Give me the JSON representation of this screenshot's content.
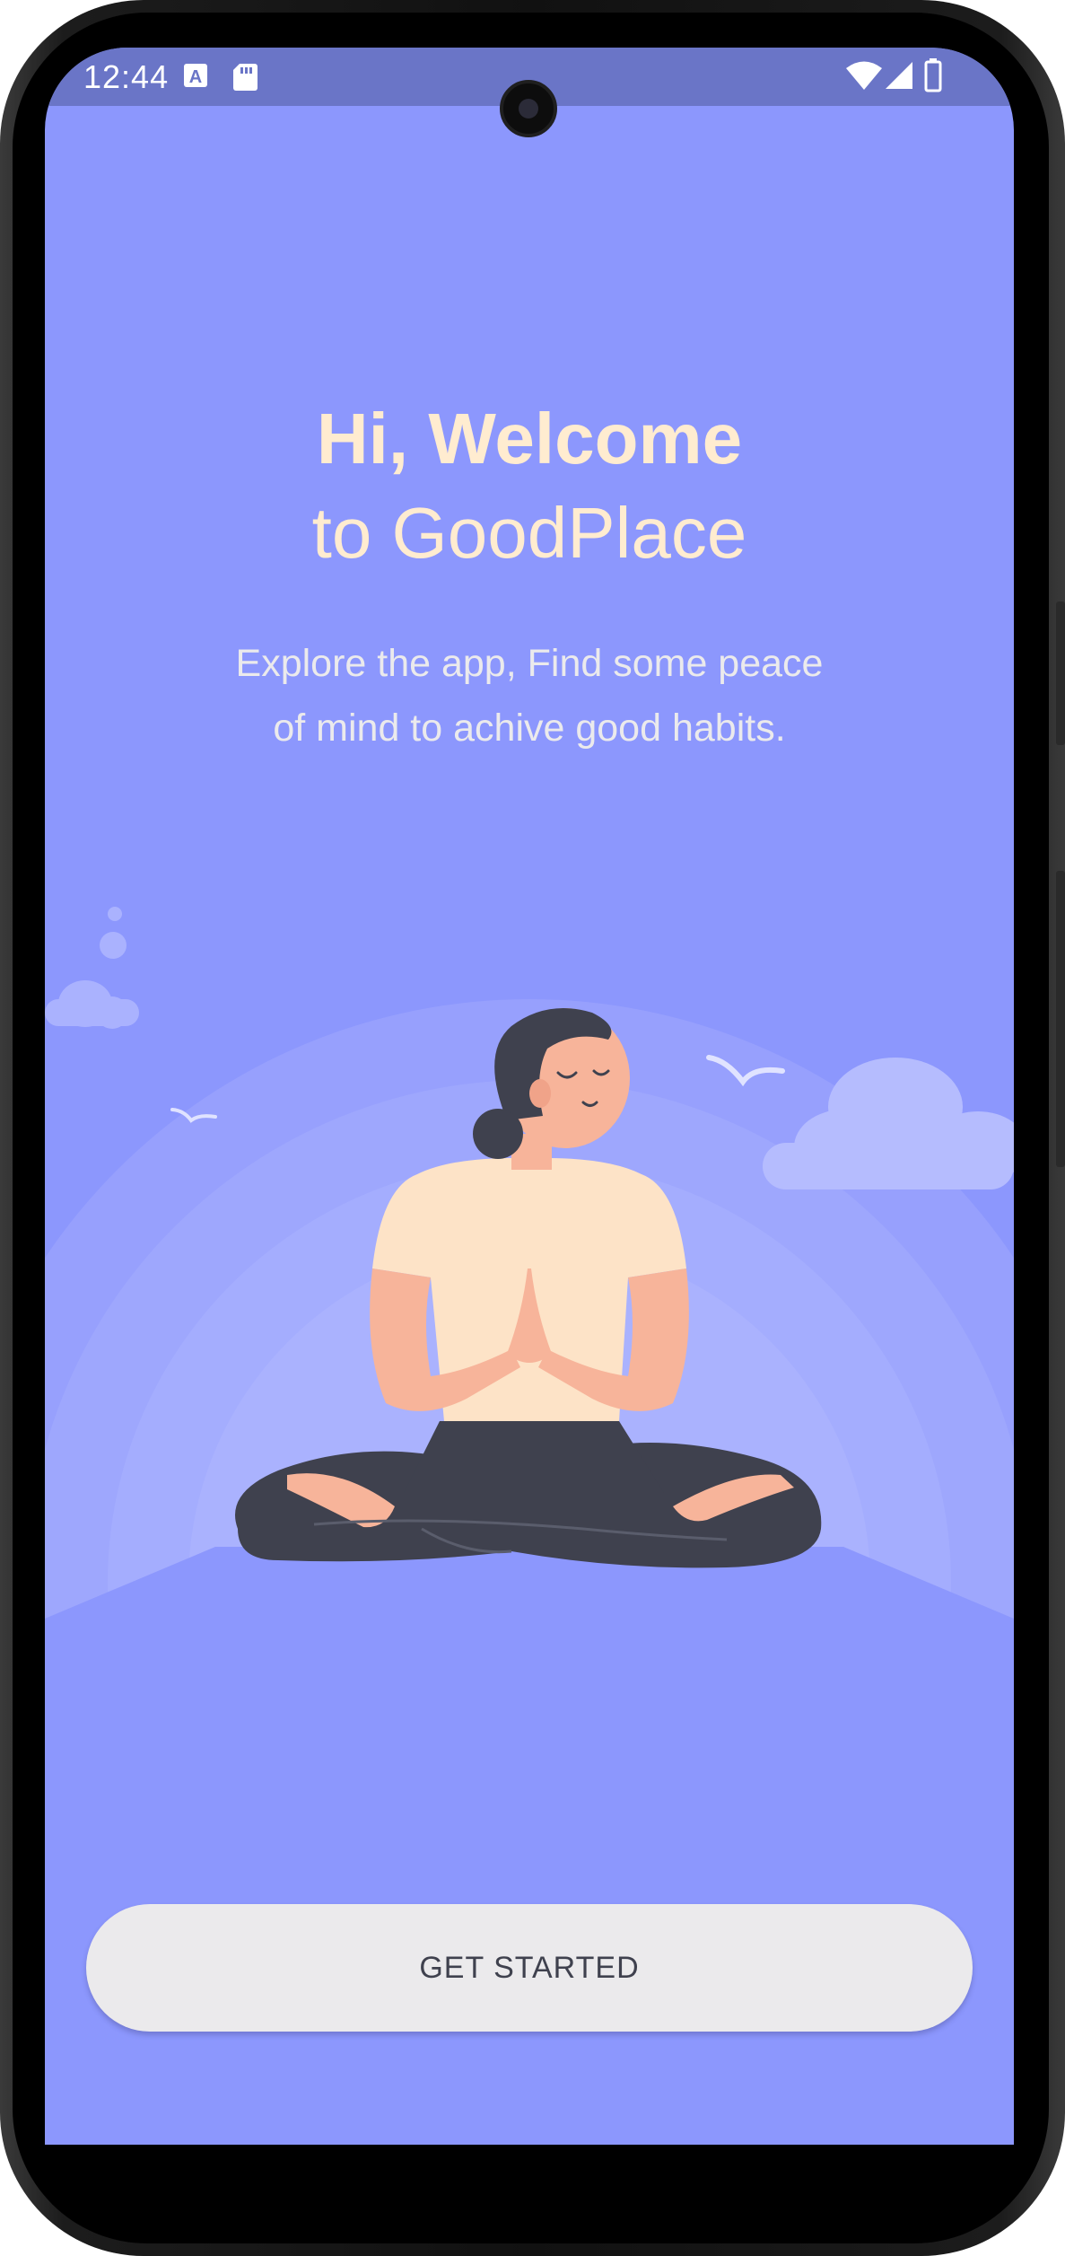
{
  "status_bar": {
    "time": "12:44",
    "icons": [
      "keyboard-a-icon",
      "sd-card-icon",
      "wifi-icon",
      "cellular-signal-icon",
      "battery-icon"
    ]
  },
  "welcome": {
    "greeting": "Hi, Welcome",
    "app_line": "to GoodPlace",
    "subtitle_line1": "Explore the app, Find some peace",
    "subtitle_line2": "of mind to achive good habits."
  },
  "cta": {
    "label": "GET STARTED"
  },
  "colors": {
    "background": "#8c97fd",
    "status_bar": "#6a75c7",
    "headline": "#ffecd0",
    "subtitle": "#ebeaec",
    "button_bg": "#ebeaec",
    "button_text": "#3f414e"
  }
}
